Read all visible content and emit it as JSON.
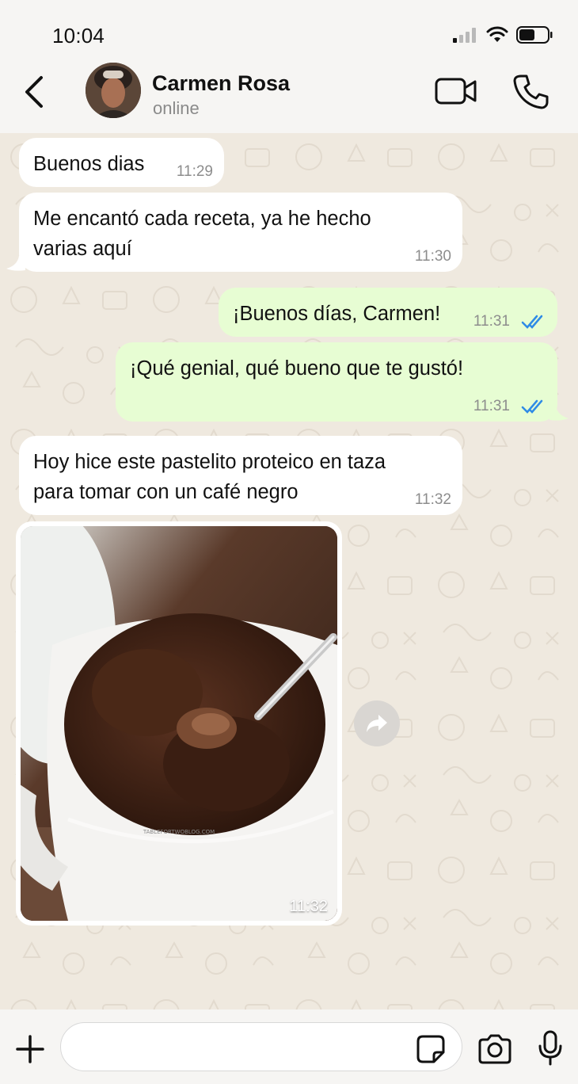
{
  "status_bar": {
    "time": "10:04",
    "battery_level": 0.55
  },
  "header": {
    "contact_name": "Carmen Rosa",
    "contact_status": "online"
  },
  "messages": [
    {
      "direction": "incoming",
      "text": "Buenos dias",
      "time": "11:29"
    },
    {
      "direction": "incoming",
      "text": "Me encantó cada receta, ya he hecho varias aquí",
      "time": "11:30"
    },
    {
      "direction": "outgoing",
      "text": "¡Buenos días, Carmen!",
      "time": "11:31",
      "status": "read"
    },
    {
      "direction": "outgoing",
      "text": "¡Qué genial, qué bueno que te gustó!",
      "time": "11:31",
      "status": "read"
    },
    {
      "direction": "incoming",
      "text": "Hoy hice este pastelito proteico en taza para tomar con un café negro",
      "time": "11:32"
    },
    {
      "direction": "incoming",
      "type": "image",
      "image_caption_watermark": "TABLEFORTWOBLOG.COM",
      "time": "11:32"
    }
  ],
  "input": {
    "value": "",
    "placeholder": ""
  },
  "colors": {
    "outgoing_bubble": "#e7fdd3",
    "incoming_bubble": "#ffffff",
    "read_ticks": "#2f8be6",
    "chat_background": "#efe9df"
  },
  "icons": {
    "back": "chevron-left-icon",
    "video": "video-camera-icon",
    "call": "phone-icon",
    "forward": "forward-arrow-icon",
    "plus": "plus-icon",
    "sticker": "sticker-icon",
    "camera": "camera-icon",
    "mic": "microphone-icon"
  }
}
